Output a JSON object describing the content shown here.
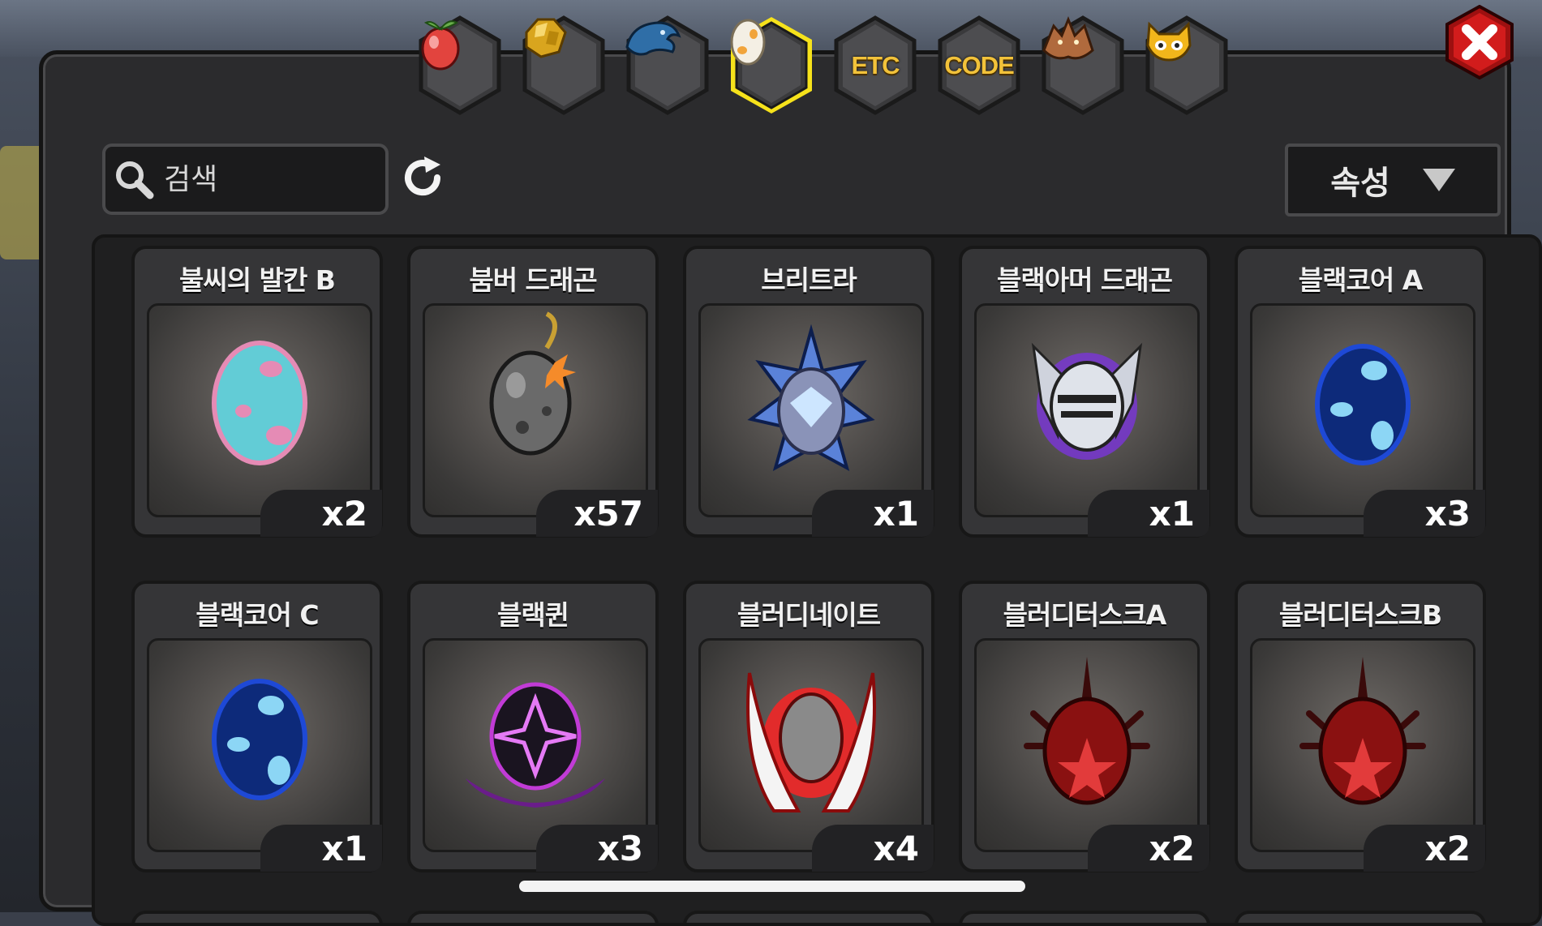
{
  "search": {
    "placeholder": "검색"
  },
  "sort": {
    "label": "속성"
  },
  "tabs": [
    {
      "name": "fruit",
      "icon": "fruit-icon"
    },
    {
      "name": "gold",
      "icon": "gold-ore-icon"
    },
    {
      "name": "dragon-scale",
      "icon": "dragon-head-icon"
    },
    {
      "name": "egg",
      "icon": "egg-icon",
      "selected": true
    },
    {
      "name": "etc",
      "label": "ETC"
    },
    {
      "name": "code",
      "label": "CODE"
    },
    {
      "name": "dragon",
      "icon": "dragon-face-icon"
    },
    {
      "name": "pet",
      "icon": "cat-face-icon"
    }
  ],
  "items": [
    {
      "name": "불씨의 발칸 B",
      "count": "x2",
      "art": "egg-cyan-pink"
    },
    {
      "name": "붐버 드래곤",
      "count": "x57",
      "art": "egg-bomb"
    },
    {
      "name": "브리트라",
      "count": "x1",
      "art": "egg-crystal-blue"
    },
    {
      "name": "블랙아머 드래곤",
      "count": "x1",
      "art": "egg-knight-helmet"
    },
    {
      "name": "블랙코어 A",
      "count": "x3",
      "art": "egg-black-core"
    },
    {
      "name": "블랙코어 C",
      "count": "x1",
      "art": "egg-black-core"
    },
    {
      "name": "블랙퀸",
      "count": "x3",
      "art": "egg-black-queen"
    },
    {
      "name": "블러디네이트",
      "count": "x4",
      "art": "egg-red-spikes"
    },
    {
      "name": "블러디터스크A",
      "count": "x2",
      "art": "egg-red-tusk"
    },
    {
      "name": "블러디터스크B",
      "count": "x2",
      "art": "egg-red-tusk"
    }
  ],
  "colors": {
    "accent_selected": "#f6e21b",
    "panel": "#2b2b2d",
    "close_button": "#d21c1c",
    "code_text": "#f2c23a"
  }
}
